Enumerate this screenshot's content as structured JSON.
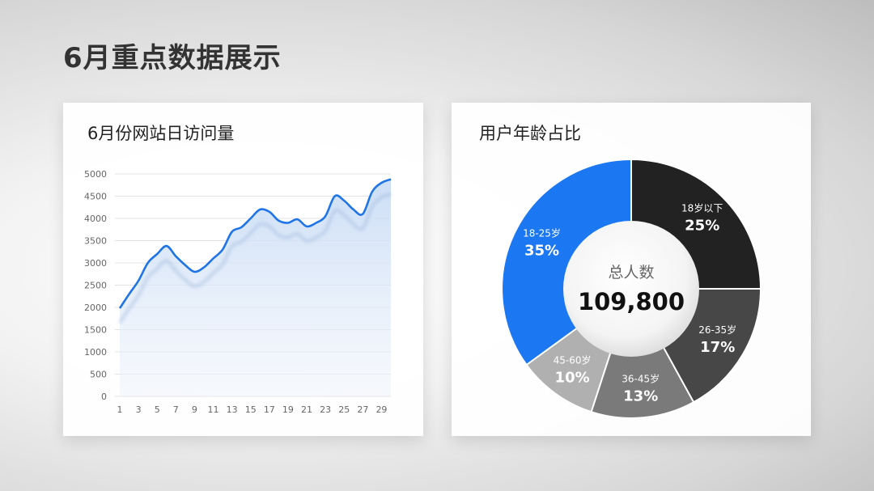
{
  "page": {
    "title": "6月重点数据展示"
  },
  "colors": {
    "line": "#1f74e6",
    "area_top": "#c9dcf5",
    "area_bottom": "#eef3fb",
    "grid": "#e3e3e3",
    "donut": [
      "#222222",
      "#474747",
      "#7a7a7a",
      "#b0b0b0",
      "#1c77f2"
    ]
  },
  "line_chart": {
    "title": "6月份网站日访问量"
  },
  "donut_chart": {
    "title": "用户年龄占比",
    "center_label": "总人数",
    "center_value": "109,800"
  },
  "chart_data": [
    {
      "type": "area",
      "title": "6月份网站日访问量",
      "x": [
        1,
        2,
        3,
        4,
        5,
        6,
        7,
        8,
        9,
        10,
        11,
        12,
        13,
        14,
        15,
        16,
        17,
        18,
        19,
        20,
        21,
        22,
        23,
        24,
        25,
        26,
        27,
        28,
        29,
        30
      ],
      "x_ticks": [
        1,
        3,
        5,
        7,
        9,
        11,
        13,
        15,
        17,
        19,
        21,
        23,
        25,
        27,
        29
      ],
      "y_ticks": [
        0,
        500,
        1000,
        1500,
        2000,
        2500,
        3000,
        3500,
        4000,
        4500,
        5000
      ],
      "ylim": [
        0,
        5000
      ],
      "grid": true,
      "series": [
        {
          "values": [
            1980,
            2300,
            2600,
            3000,
            3200,
            3380,
            3150,
            2950,
            2800,
            2900,
            3100,
            3300,
            3700,
            3800,
            4000,
            4200,
            4150,
            3950,
            3900,
            3980,
            3820,
            3900,
            4050,
            4500,
            4400,
            4200,
            4100,
            4600,
            4800,
            4880
          ]
        }
      ]
    },
    {
      "type": "pie",
      "title": "用户年龄占比",
      "categories": [
        "18岁以下",
        "26-35岁",
        "36-45岁",
        "45-60岁",
        "18-25岁"
      ],
      "values": [
        25,
        17,
        13,
        10,
        35
      ],
      "labels": [
        "25%",
        "17%",
        "13%",
        "10%",
        "35%"
      ],
      "total": 109800
    }
  ]
}
